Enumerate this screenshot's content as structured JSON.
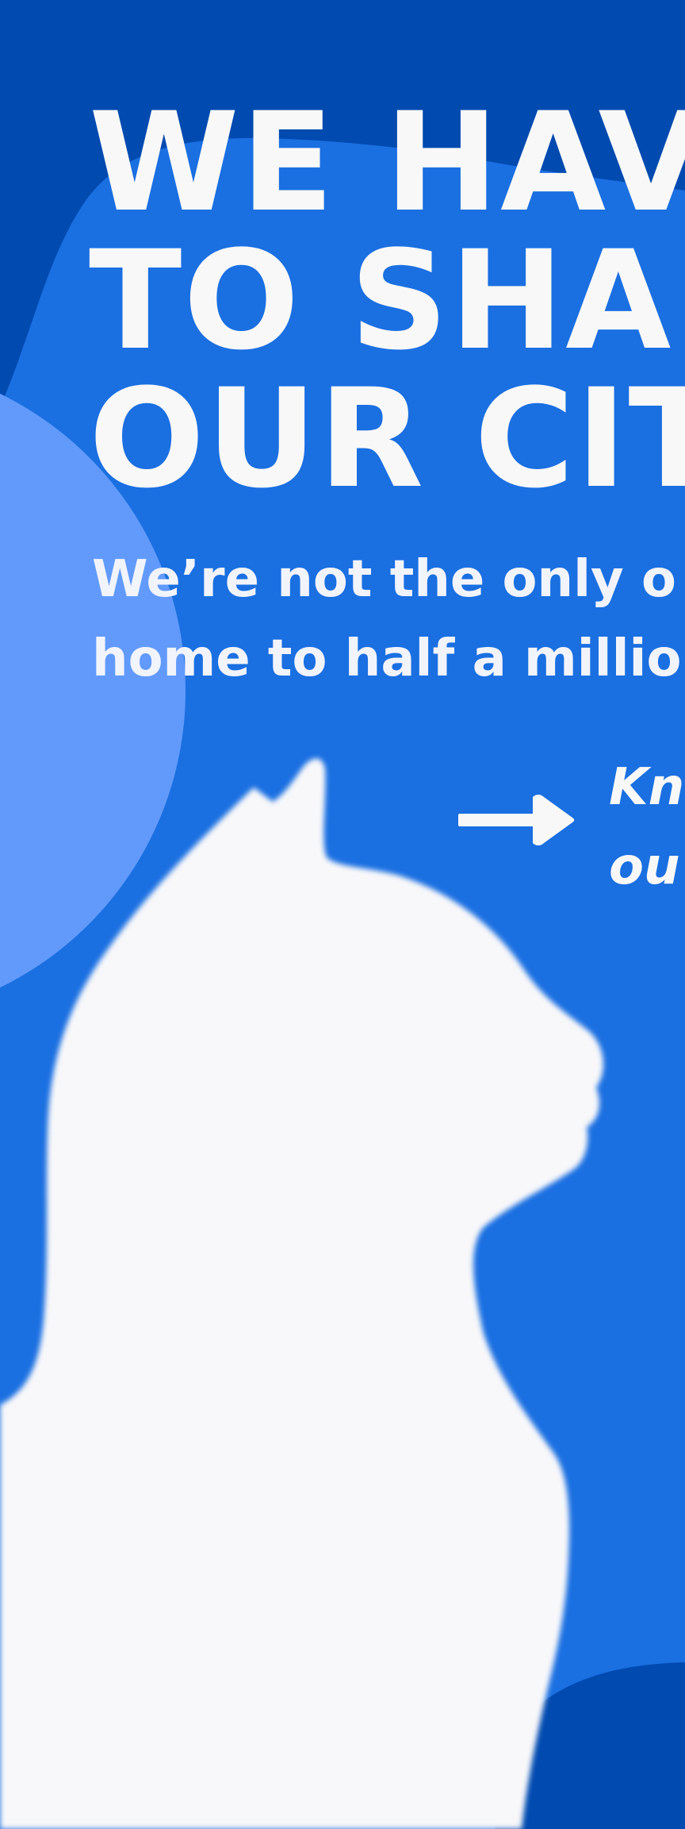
{
  "headline": {
    "line1": "WE HAVE",
    "line2": "TO SHARE",
    "line3": "OUR CITY"
  },
  "subtitle": {
    "line1": "We’re not the only o",
    "line2": "home to half a millio"
  },
  "cta": {
    "line1": "Kn",
    "line2": "ou"
  },
  "icons": {
    "arrow": "arrow-right-icon",
    "silhouette": "cat-silhouette"
  },
  "colors": {
    "background": "#1a6fe1",
    "dark_blue": "#004ab0",
    "light_blue": "#619afb",
    "text": "#f8f8f8",
    "silhouette": "#f8f8fa"
  }
}
